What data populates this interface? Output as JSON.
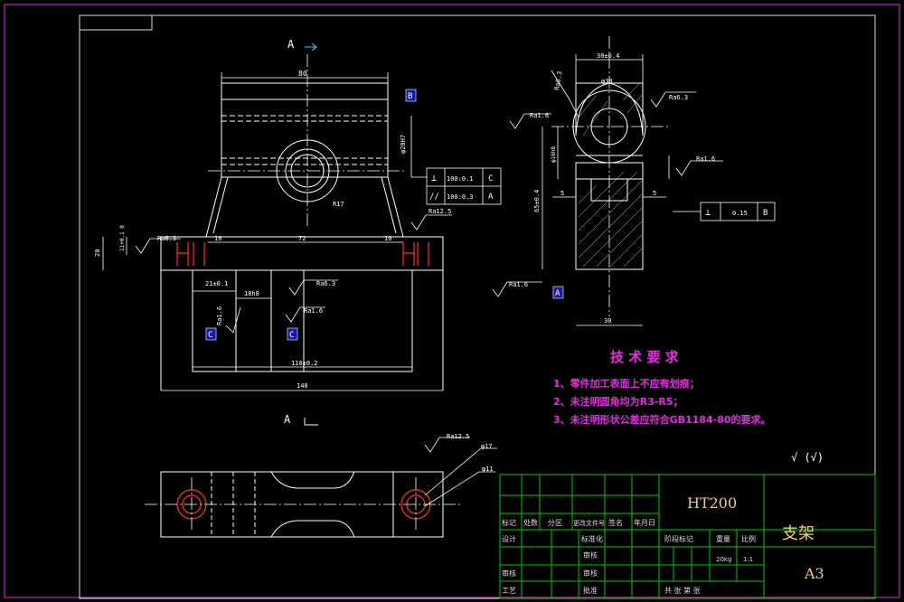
{
  "views": {
    "section_label_top": "A",
    "section_label_bottom": "A",
    "datum_b": "B",
    "datum_a": "A",
    "datum_c1": "C",
    "datum_c2": "C"
  },
  "dimensions": {
    "width_80": "80",
    "height_20h7": "φ20H7",
    "radius_r17": "R17",
    "len_10_left": "10",
    "len_72": "72",
    "len_10_right": "10",
    "height_20": "20",
    "height_11": "11+0.1 0",
    "len_21": "21±0.1",
    "len_18h8": "18h8",
    "len_110": "110±0.2",
    "len_140": "140",
    "width_30_top": "30±0.4",
    "dia_38": "φ38",
    "height_65": "65±0.4",
    "dia_16": "φ16h8",
    "dia_5_left": "5",
    "dia_5_right": "5",
    "width_30_bottom": "30",
    "dia_17": "φ17",
    "dia_11": "φ11"
  },
  "roughness": {
    "ra63_left": "Ra6.3",
    "ra125_front": "Ra12.5",
    "ra63_mid": "Ra6.3",
    "ra16_mid": "Ra1.6",
    "ra16_c": "Ra1.6",
    "ra63_side_top": "Ra6.3",
    "ra16_side_left": "Ra1.6",
    "ra63_side_right": "Ra6.3",
    "ra16_side_right": "Ra1.6",
    "ra16_side_bottom": "Ra1.6",
    "ra125_plan": "Ra12.5"
  },
  "tolerances": {
    "perp_symbol": "⊥",
    "perp_value": "100:0.1",
    "perp_datum": "C",
    "par_symbol": "//",
    "par_value": "100:0.3",
    "par_datum": "A",
    "perp2_symbol": "⊥",
    "perp2_value": "0.15",
    "perp2_datum": "B"
  },
  "notes": {
    "title": "技 术 要 求",
    "items": [
      "1、零件加工表面上不应有划痕；",
      "2、未注明圆角均为R3-R5；",
      "3、未注明形状公差应符合GB1184-80的要求。"
    ],
    "general_roughness": "√ (√)"
  },
  "title_block": {
    "material": "HT200",
    "part_name": "支架",
    "sheet_size": "A3",
    "weight": "20kg",
    "scale": "1:1",
    "labels": {
      "mark": "标记",
      "count": "处数",
      "zone": "分区",
      "change_doc": "更改文件号",
      "signature": "签名",
      "date": "年月日",
      "design": "设计",
      "standardize": "标准化",
      "review": "审核",
      "process": "工艺",
      "approve": "批准",
      "stage_mark": "阶段标记",
      "weight_label": "重量",
      "scale_label": "比例",
      "sheets": "共  张 第  张",
      "reviewed": "审核",
      "examine": "审核"
    }
  },
  "colors": {
    "background": "#000000",
    "border": "#e030e0",
    "lines": "#ffffff",
    "title_grid": "#00c800",
    "centerline": "#ff3030",
    "notes": "#e030e0",
    "datum_box": "#1a1aaa"
  }
}
